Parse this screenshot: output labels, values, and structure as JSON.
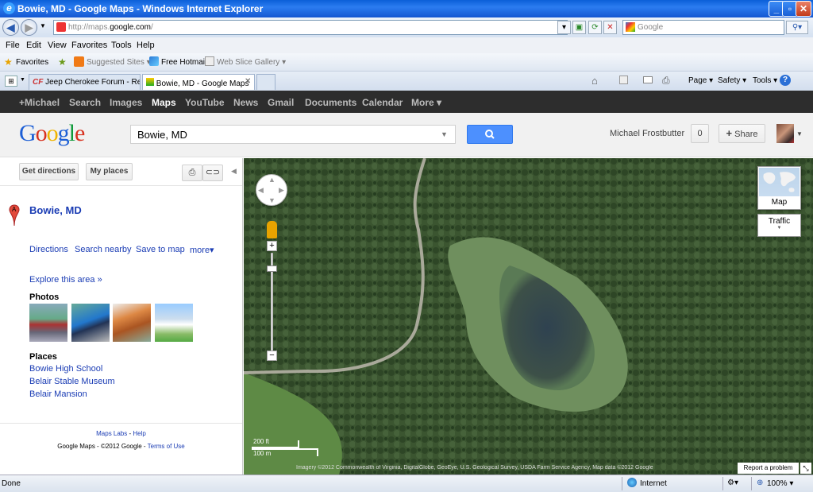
{
  "window": {
    "title": "Bowie, MD - Google Maps - Windows Internet Explorer"
  },
  "addressbar": {
    "url_prefix": "http://maps.",
    "url_domain": "google.com",
    "url_suffix": "/",
    "search_placeholder": "Google"
  },
  "menu": [
    "File",
    "Edit",
    "View",
    "Favorites",
    "Tools",
    "Help"
  ],
  "favorites": {
    "label": "Favorites",
    "items": [
      "Suggested Sites ▾",
      "Free Hotmail",
      "Web Slice Gallery ▾"
    ]
  },
  "tabs": [
    {
      "label": "Jeep Cherokee Forum - Repl..."
    },
    {
      "label": "Bowie, MD - Google Maps"
    }
  ],
  "commandbar": {
    "page": "Page ▾",
    "safety": "Safety ▾",
    "tools": "Tools ▾"
  },
  "gbar": [
    "+Michael",
    "Search",
    "Images",
    "Maps",
    "YouTube",
    "News",
    "Gmail",
    "Documents",
    "Calendar",
    "More ▾"
  ],
  "header": {
    "search_value": "Bowie, MD",
    "username": "Michael Frostbutter",
    "count": "0",
    "share": "Share"
  },
  "sidebar": {
    "get_directions": "Get directions",
    "my_places": "My places",
    "marker_letter": "A",
    "place_title": "Bowie, MD",
    "actions": [
      "Directions",
      "Search nearby",
      "Save to map",
      "more▾"
    ],
    "explore": "Explore this area »",
    "photos_heading": "Photos",
    "places_heading": "Places",
    "places": [
      "Bowie High School",
      "Belair Stable Museum",
      "Belair Mansion"
    ],
    "footer_labs": "Maps Labs",
    "footer_dash1": "-",
    "footer_help": "Help",
    "footer_copyright": "Google Maps - ©2012 Google -",
    "footer_terms": "Terms of Use"
  },
  "map": {
    "map_type_label": "Map",
    "traffic_label": "Traffic",
    "scale_ft": "200 ft",
    "scale_m": "100 m",
    "attribution": "Imagery ©2012 Commonwealth of Virginia, DigitalGlobe, GeoEye, U.S. Geological Survey, USDA Farm Service Agency, Map data ©2012 Google",
    "report": "Report a problem"
  },
  "status": {
    "left": "Done",
    "zone": "Internet",
    "zoom": "100% ▾"
  }
}
